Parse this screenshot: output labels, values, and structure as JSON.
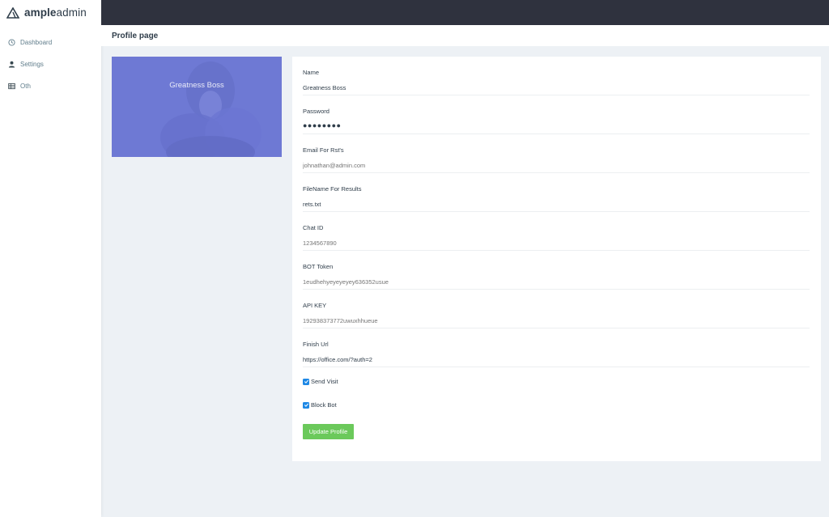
{
  "brand": {
    "bold": "ample",
    "light": "admin"
  },
  "sidebar": {
    "items": [
      {
        "label": "Dashboard",
        "icon": "clock-icon"
      },
      {
        "label": "Settings",
        "icon": "user-icon"
      },
      {
        "label": "Oth",
        "icon": "table-icon"
      }
    ]
  },
  "header": {
    "title": "Profile page"
  },
  "profile": {
    "name": "Greatness Boss"
  },
  "form": {
    "fields": [
      {
        "label": "Name",
        "value": "Greatness Boss"
      },
      {
        "label": "Password",
        "value": "●●●●●●●●"
      },
      {
        "label": "Email For Rst's",
        "placeholder": "johnathan@admin.com"
      },
      {
        "label": "FileName For Results",
        "value": "rets.txt"
      },
      {
        "label": "Chat ID",
        "placeholder": "1234567890"
      },
      {
        "label": "BOT Token",
        "placeholder": "1eudhehyeyeyeyey636352usue"
      },
      {
        "label": "API KEY",
        "placeholder": "192938373772uwuxhhueue"
      },
      {
        "label": "Finish Url",
        "value": "https://office.com/?auth=2"
      }
    ],
    "checkboxes": [
      {
        "label": "Send Visit",
        "checked": true
      },
      {
        "label": "Block Bot",
        "checked": true
      }
    ],
    "submit_label": "Update Profile"
  },
  "colors": {
    "topbar": "#2f323e",
    "accent": "#6bc95b",
    "profile_bg": "#6f7ad6",
    "checkbox": "#1e88e5"
  }
}
